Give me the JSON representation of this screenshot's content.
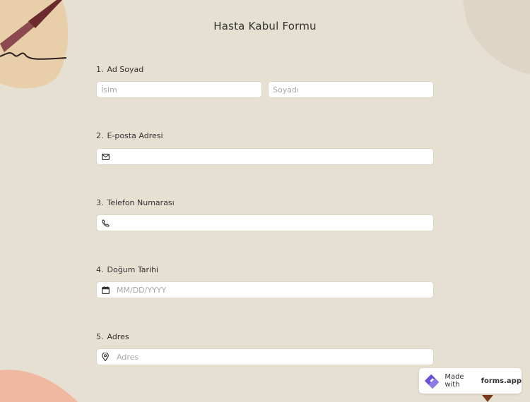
{
  "form": {
    "title": "Hasta Kabul Formu"
  },
  "questions": [
    {
      "number": "1.",
      "label": "Ad Soyad",
      "fields": [
        {
          "placeholder": "İsim"
        },
        {
          "placeholder": "Soyadı"
        }
      ]
    },
    {
      "number": "2.",
      "label": "E-posta Adresi",
      "icon": "envelope-icon",
      "placeholder": ""
    },
    {
      "number": "3.",
      "label": "Telefon Numarası",
      "icon": "phone-icon",
      "placeholder": ""
    },
    {
      "number": "4.",
      "label": "Doğum Tarihi",
      "icon": "calendar-icon",
      "placeholder": "MM/DD/YYYY"
    },
    {
      "number": "5.",
      "label": "Adres",
      "icon": "location-pin-icon",
      "placeholder": "Adres"
    }
  ],
  "badge": {
    "prefix": "Made with",
    "brand": "forms.app",
    "icon": "forms-app-logo"
  },
  "colors": {
    "background": "#e6e0d3",
    "field_background": "#ffffff",
    "accent": "#6a4fd6"
  }
}
